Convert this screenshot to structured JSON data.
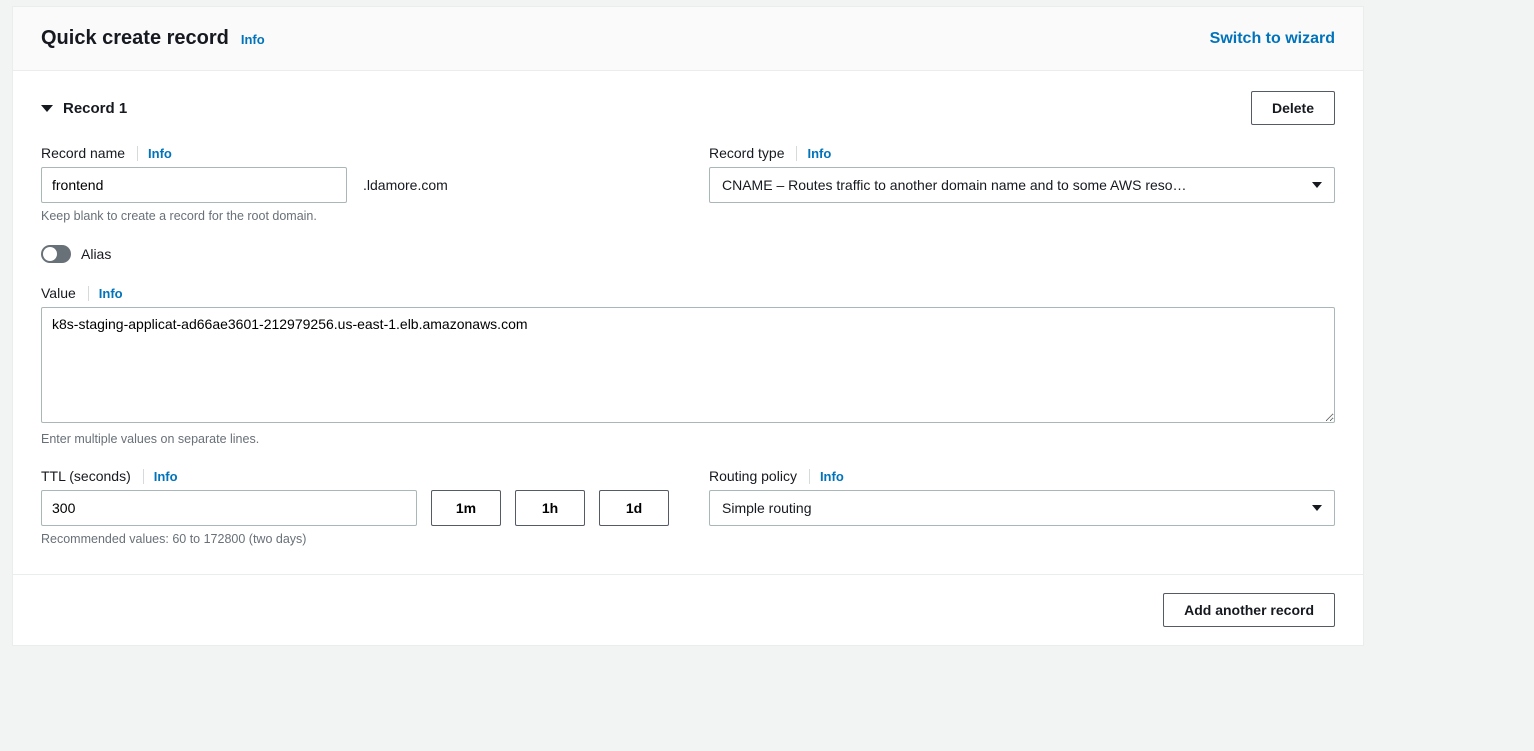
{
  "header": {
    "title": "Quick create record",
    "info": "Info",
    "switch": "Switch to wizard"
  },
  "record": {
    "toggle_label": "Record 1",
    "delete_label": "Delete"
  },
  "record_name": {
    "label": "Record name",
    "info": "Info",
    "value": "frontend",
    "suffix": ".ldamore.com",
    "hint": "Keep blank to create a record for the root domain."
  },
  "record_type": {
    "label": "Record type",
    "info": "Info",
    "selected": "CNAME – Routes traffic to another domain name and to some AWS reso…"
  },
  "alias": {
    "label": "Alias"
  },
  "value_field": {
    "label": "Value",
    "info": "Info",
    "text": "k8s-staging-applicat-ad66ae3601-212979256.us-east-1.elb.amazonaws.com",
    "hint": "Enter multiple values on separate lines."
  },
  "ttl": {
    "label": "TTL (seconds)",
    "info": "Info",
    "value": "300",
    "btn_1m": "1m",
    "btn_1h": "1h",
    "btn_1d": "1d",
    "hint": "Recommended values: 60 to 172800 (two days)"
  },
  "routing": {
    "label": "Routing policy",
    "info": "Info",
    "selected": "Simple routing"
  },
  "footer": {
    "add_label": "Add another record"
  }
}
